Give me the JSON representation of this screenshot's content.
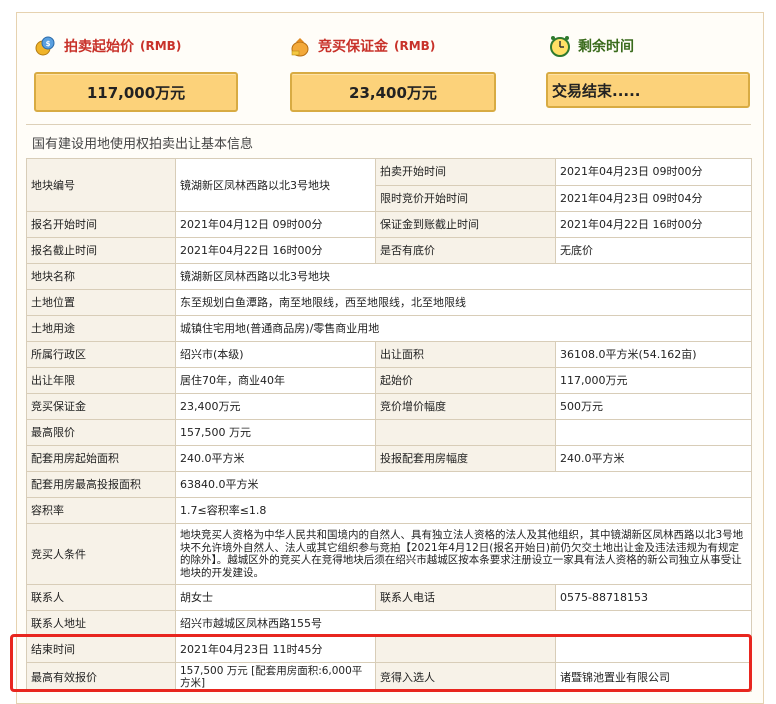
{
  "stats": {
    "start_price_label": "拍卖起始价",
    "start_price_unit": "(RMB)",
    "start_price_icon": "money-coins-icon",
    "start_price_value": "117,000万元",
    "deposit_label": "竞买保证金",
    "deposit_unit": "(RMB)",
    "deposit_icon": "money-bag-icon",
    "deposit_value": "23,400万元",
    "remaining_label": "剩余时间",
    "remaining_icon": "alarm-clock-icon",
    "remaining_value": "交易结束....."
  },
  "section_title": "国有建设用地使用权拍卖出让基本信息",
  "colors": {
    "accent_red": "#c8322a",
    "box_fill": "#fcd27a",
    "box_border": "#d8ab43",
    "highlight_border": "#e8261f"
  },
  "table": {
    "plot_no_label": "地块编号",
    "plot_no_value": "镜湖新区凤林西路以北3号地块",
    "auction_start_label": "拍卖开始时间",
    "auction_start_value": "2021年04月23日 09时00分",
    "timed_bid_label": "限时竞价开始时间",
    "timed_bid_value": "2021年04月23日 09时04分",
    "reg_start_label": "报名开始时间",
    "reg_start_value": "2021年04月12日 09时00分",
    "deposit_deadline_label": "保证金到账截止时间",
    "deposit_deadline_value": "2021年04月22日 16时00分",
    "reg_end_label": "报名截止时间",
    "reg_end_value": "2021年04月22日 16时00分",
    "reserve_label": "是否有底价",
    "reserve_value": "无底价",
    "plot_name_label": "地块名称",
    "plot_name_value": "镜湖新区凤林西路以北3号地块",
    "location_label": "土地位置",
    "location_value": "东至规划白鱼潭路，南至地限线，西至地限线，北至地限线",
    "usage_label": "土地用途",
    "usage_value": "城镇住宅用地(普通商品房)/零售商业用地",
    "district_label": "所属行政区",
    "district_value": "绍兴市(本级)",
    "area_label": "出让面积",
    "area_value": "36108.0平方米(54.162亩)",
    "term_label": "出让年限",
    "term_value": "居住70年，商业40年",
    "starting_price_label": "起始价",
    "starting_price_value": "117,000万元",
    "bid_deposit_label": "竞买保证金",
    "bid_deposit_value": "23,400万元",
    "increment_label": "竞价增价幅度",
    "increment_value": "500万元",
    "max_price_label": "最高限价",
    "max_price_value": "157,500 万元",
    "housing_start_label": "配套用房起始面积",
    "housing_start_value": "240.0平方米",
    "housing_step_label": "投报配套用房幅度",
    "housing_step_value": "240.0平方米",
    "housing_max_label": "配套用房最高投报面积",
    "housing_max_value": "63840.0平方米",
    "far_label": "容积率",
    "far_value": "1.7≤容积率≤1.8",
    "bidder_cond_label": "竞买人条件",
    "bidder_cond_value": "地块竞买人资格为中华人民共和国境内的自然人、具有独立法人资格的法人及其他组织，其中镜湖新区凤林西路以北3号地块不允许境外自然人、法人或其它组织参与竞拍【2021年4月12日(报名开始日)前仍欠交土地出让金及违法违规为有规定的除外】。越城区外的竞买人在竞得地块后须在绍兴市越城区按本条要求注册设立一家具有法人资格的新公司独立从事受让地块的开发建设。",
    "contact_label": "联系人",
    "contact_value": "胡女士",
    "phone_label": "联系人电话",
    "phone_value": "0575-88718153",
    "address_label": "联系人地址",
    "address_value": "绍兴市越城区凤林西路155号",
    "end_time_label": "结束时间",
    "end_time_value": "2021年04月23日 11时45分",
    "best_bid_label": "最高有效报价",
    "best_bid_value": "157,500 万元 [配套用房面积:6,000平方米]",
    "winner_label": "竞得入选人",
    "winner_value": "诸暨锦池置业有限公司"
  }
}
